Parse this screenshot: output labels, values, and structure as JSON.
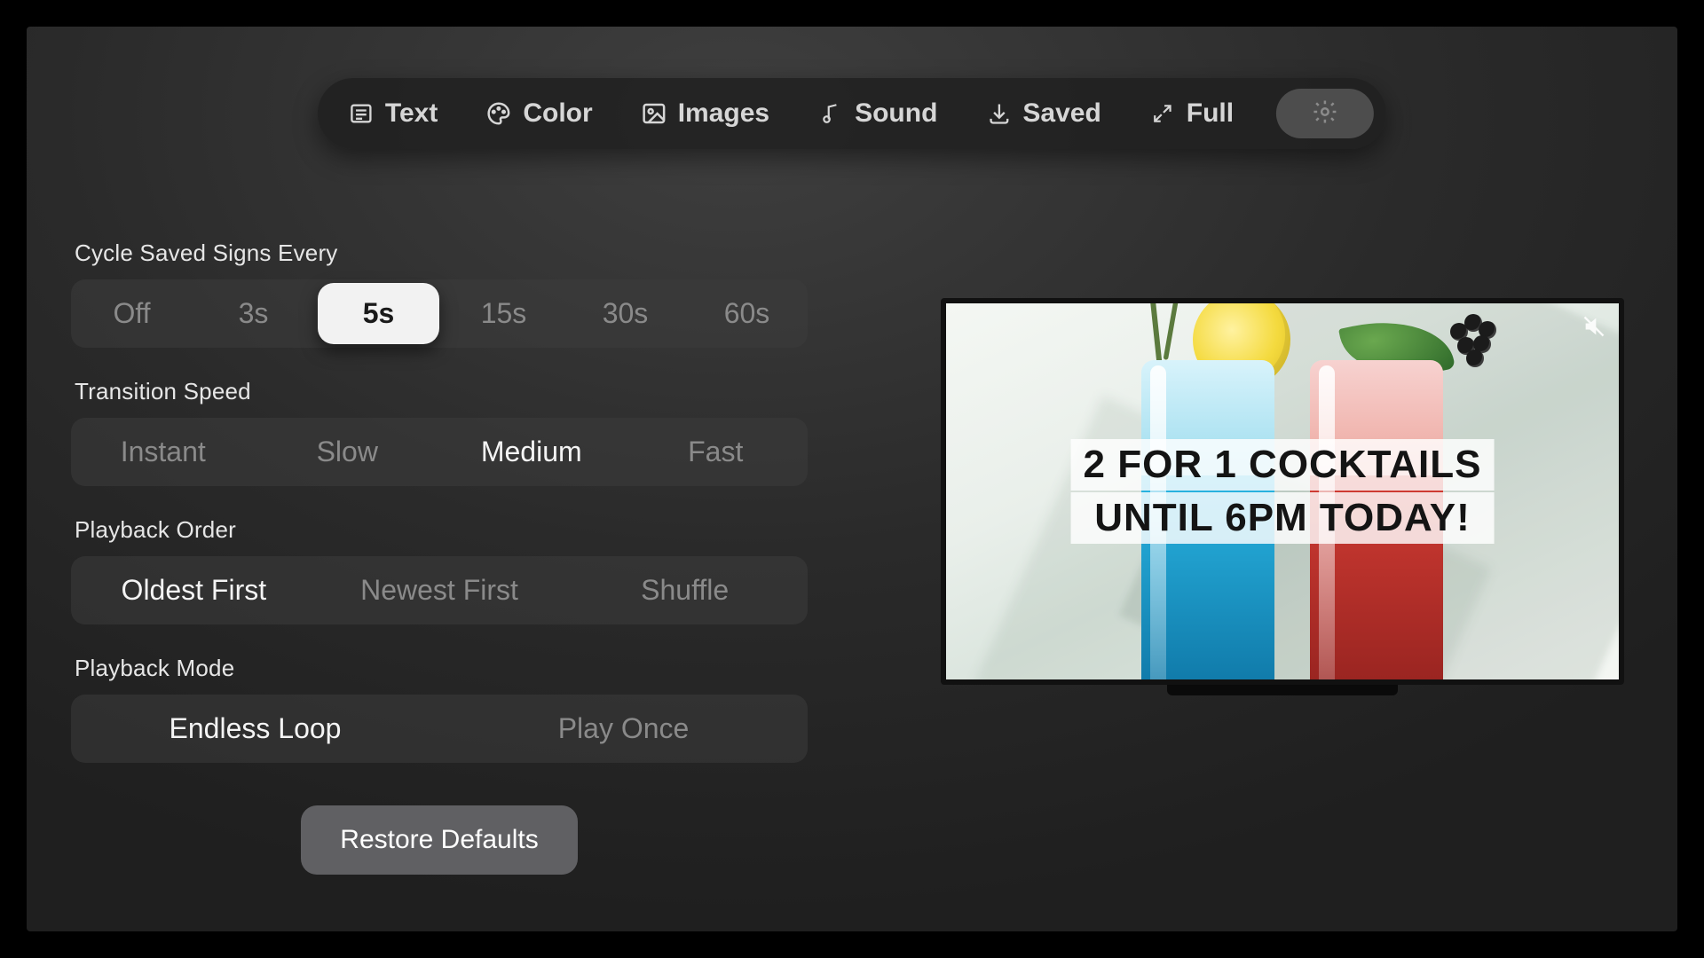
{
  "toolbar": {
    "tabs": [
      {
        "id": "text",
        "label": "Text",
        "icon": "text-icon"
      },
      {
        "id": "color",
        "label": "Color",
        "icon": "palette-icon"
      },
      {
        "id": "images",
        "label": "Images",
        "icon": "image-icon"
      },
      {
        "id": "sound",
        "label": "Sound",
        "icon": "music-note-icon"
      },
      {
        "id": "saved",
        "label": "Saved",
        "icon": "download-icon"
      },
      {
        "id": "full",
        "label": "Full",
        "icon": "expand-icon"
      }
    ],
    "settings_icon": "gear-icon",
    "settings_active": true
  },
  "settings": {
    "cycle": {
      "label": "Cycle Saved Signs Every",
      "options": [
        "Off",
        "3s",
        "5s",
        "15s",
        "30s",
        "60s"
      ],
      "selected": "5s"
    },
    "transition": {
      "label": "Transition Speed",
      "options": [
        "Instant",
        "Slow",
        "Medium",
        "Fast"
      ],
      "selected": "Medium"
    },
    "order": {
      "label": "Playback Order",
      "options": [
        "Oldest First",
        "Newest First",
        "Shuffle"
      ],
      "selected": "Oldest First"
    },
    "mode": {
      "label": "Playback Mode",
      "options": [
        "Endless Loop",
        "Play Once"
      ],
      "selected": "Endless Loop"
    },
    "restore_label": "Restore Defaults"
  },
  "preview": {
    "line1": "2 FOR 1 COCKTAILS",
    "line2": "UNTIL 6PM TODAY!",
    "muted": true
  }
}
